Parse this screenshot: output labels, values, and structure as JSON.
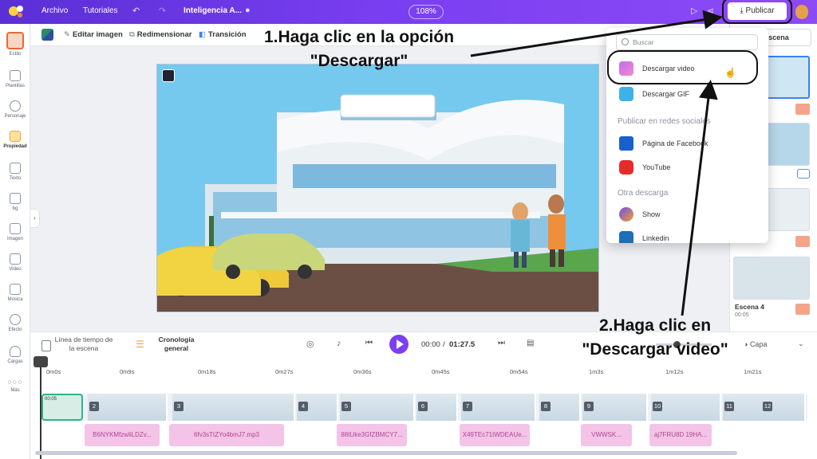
{
  "topbar": {
    "menu_file": "Archivo",
    "menu_tutorials": "Tutoriales",
    "project_title": "Inteligencia A...",
    "zoom": "108%",
    "publish_label": "Publicar"
  },
  "toolbar": {
    "edit_image": "Editar imagen",
    "resize": "Redimensionar",
    "transition": "Transición"
  },
  "sidebar": {
    "items": [
      {
        "label": "Estilo"
      },
      {
        "label": "Plantillas"
      },
      {
        "label": "Personaje"
      },
      {
        "label": "Propiedad"
      },
      {
        "label": "Texto"
      },
      {
        "label": "bg"
      },
      {
        "label": "Imagen"
      },
      {
        "label": "Video"
      },
      {
        "label": "Música"
      },
      {
        "label": "Efecto"
      },
      {
        "label": "Cargas"
      },
      {
        "label": "Más"
      }
    ]
  },
  "dropdown": {
    "search_placeholder": "Buscar",
    "download_video": "Descargar video",
    "download_gif": "Descargar GIF",
    "social_heading": "Publicar en redes sociales",
    "facebook": "Página de Facebook",
    "youtube": "YouTube",
    "other_heading": "Otra descarga",
    "show": "Show",
    "linkedin": "Linkedin"
  },
  "scene_panel": {
    "add_scene": "ar escena",
    "scene4_label": "Escena 4",
    "scene4_time": "00:05"
  },
  "timeline": {
    "scene_timeline": "Línea de tiempo de la escena",
    "general_timeline": "Cronología general",
    "time_current": "00:00",
    "time_total": "01:27.5",
    "layer_label": "Capa",
    "ticks": [
      "0m0s",
      "0m9s",
      "0m18s",
      "0m27s",
      "0m36s",
      "0m45s",
      "0m54s",
      "1m3s",
      "1m12s",
      "1m21s"
    ],
    "first_scene_time": "00:05",
    "segments": [
      "2",
      "3",
      "4",
      "5",
      "6",
      "7",
      "8",
      "9",
      "10",
      "11",
      "12"
    ],
    "audio_clips": [
      "B6NYKMfzwliLDZv...",
      "6fv3sTtZYo4bmJ7.mp3",
      "88tUke3GfZBMCY7...",
      "X49TEc71tWDEAUe...",
      "VWWSK...",
      "aj7FRU8D 19HA..."
    ]
  },
  "annotations": {
    "step1": "1.Haga clic en la opción \"Descargar\"",
    "step2": "2.Haga clic en \"Descargar video\""
  },
  "colors": {
    "brand": "#7b3ff2",
    "highlight_ring": "#111111"
  }
}
